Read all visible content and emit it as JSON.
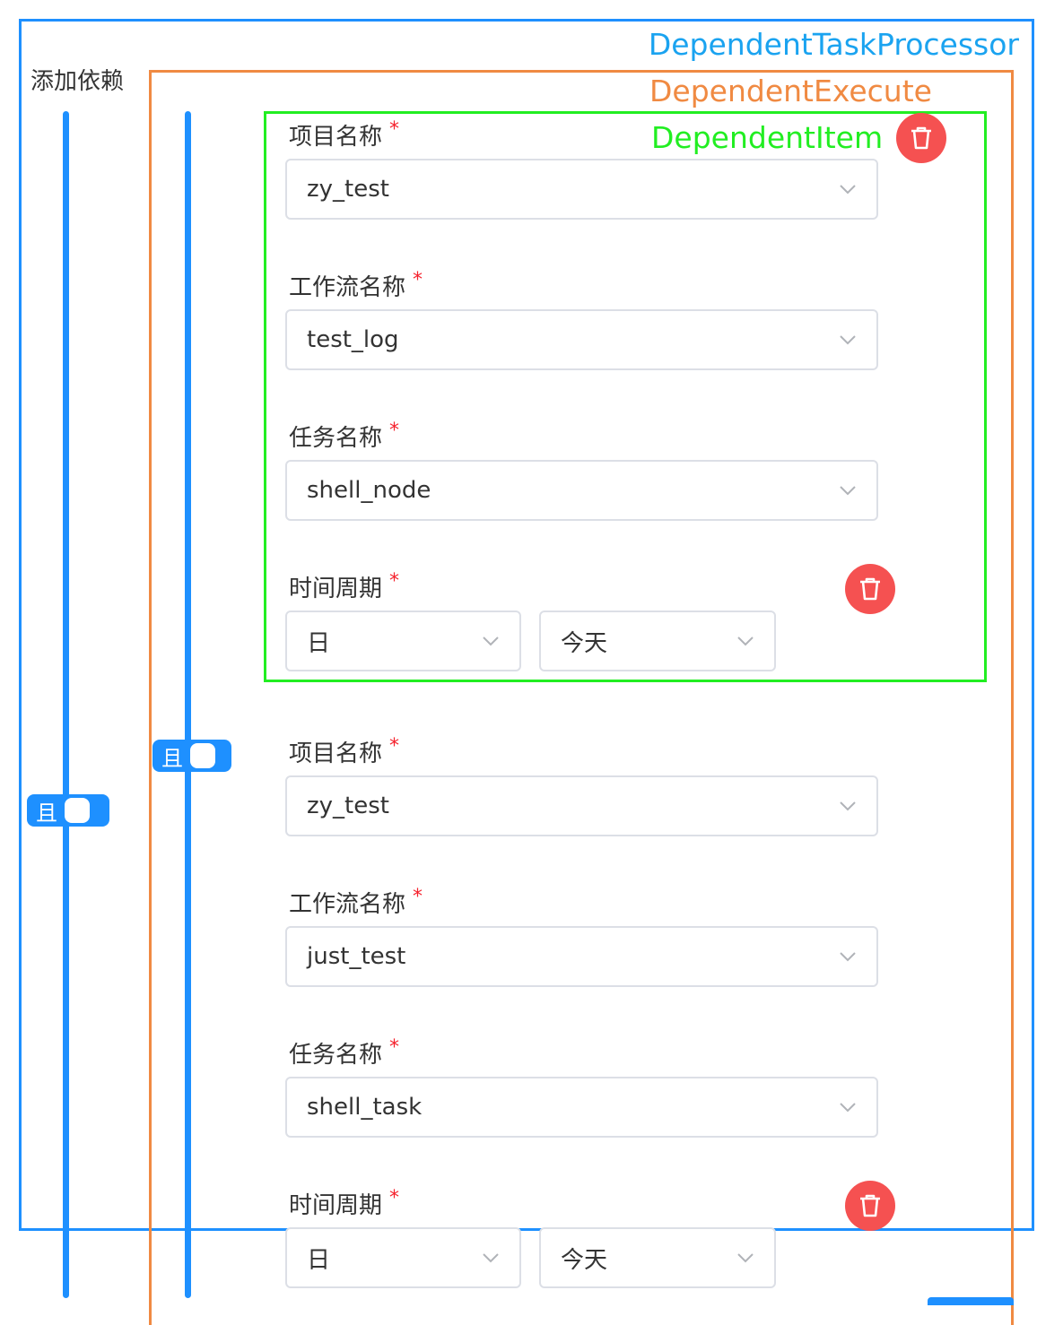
{
  "annotations": {
    "processor": "DependentTaskProcessor",
    "execute": "DependentExecute",
    "item": "DependentItem"
  },
  "add_dependency_label": "添加依赖",
  "relation_outer": "且",
  "relation_inner": "且",
  "colors": {
    "primary": "#1e90ff",
    "execute": "#f08a42",
    "item": "#22ee22",
    "danger": "#f55151",
    "required": "#f5222d"
  },
  "labels": {
    "project": "项目名称",
    "workflow": "工作流名称",
    "task": "任务名称",
    "cycle": "时间周期",
    "required_mark": "*"
  },
  "items": [
    {
      "project": "zy_test",
      "workflow": "test_log",
      "task": "shell_node",
      "cycle": "日",
      "date": "今天"
    },
    {
      "project": "zy_test",
      "workflow": "just_test",
      "task": "shell_task",
      "cycle": "日",
      "date": "今天"
    }
  ],
  "icons": {
    "delete": "trash-icon",
    "dropdown": "chevron-down-icon"
  }
}
